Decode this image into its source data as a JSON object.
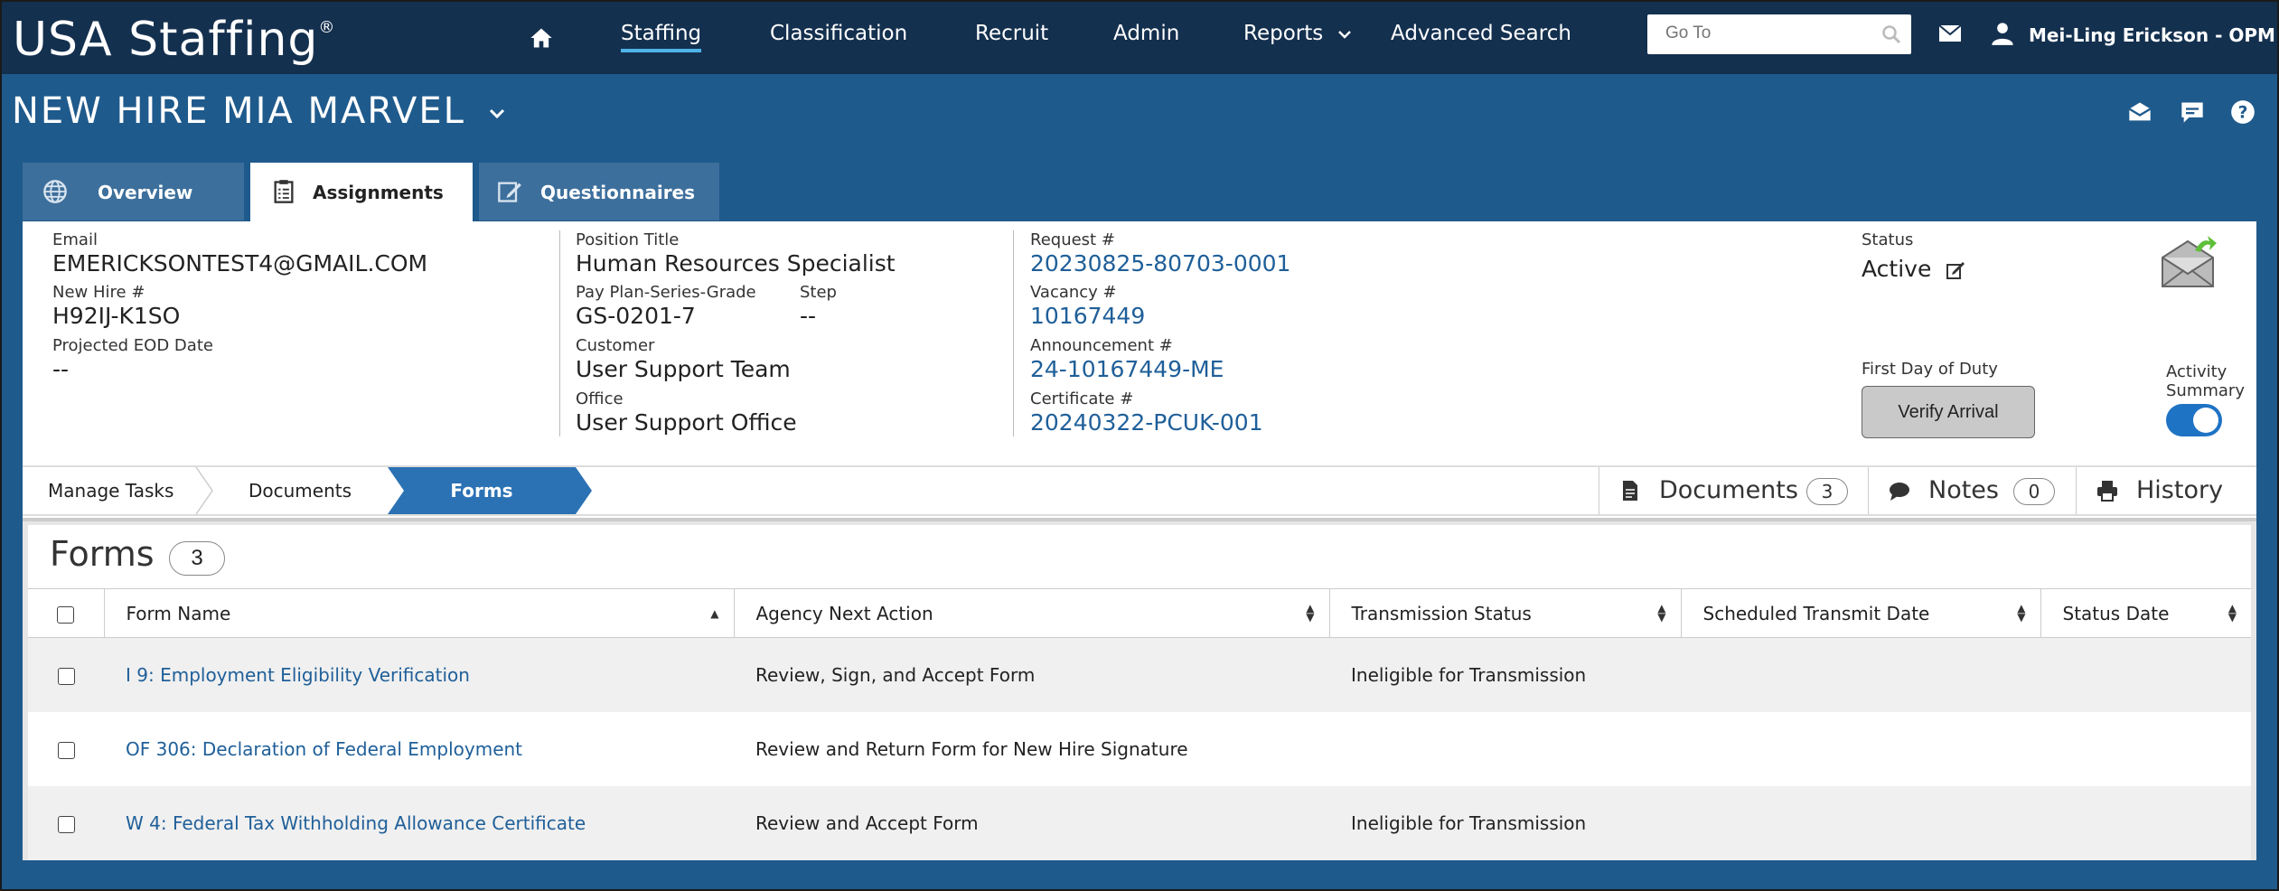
{
  "app": {
    "logo": "USA Staffing",
    "logo_mark": "®"
  },
  "nav": {
    "items": [
      "Staffing",
      "Classification",
      "Recruit",
      "Admin",
      "Reports",
      "Advanced Search"
    ],
    "active": "Staffing",
    "goto_placeholder": "Go To",
    "user_name": "Mei-Ling Erickson - OPM"
  },
  "page": {
    "title": "NEW HIRE MIA MARVEL"
  },
  "tabs": [
    "Overview",
    "Assignments",
    "Questionnaires"
  ],
  "active_tab": "Assignments",
  "info": {
    "email_label": "Email",
    "email": "EMERICKSONTEST4@GMAIL.COM",
    "new_hire_label": "New Hire #",
    "new_hire": "H92IJ-K1SO",
    "eod_label": "Projected EOD Date",
    "eod": "--",
    "position_label": "Position Title",
    "position": "Human Resources Specialist",
    "ppsg_label": "Pay Plan-Series-Grade",
    "ppsg": "GS-0201-7",
    "step_label": "Step",
    "step": "--",
    "customer_label": "Customer",
    "customer": "User Support Team",
    "office_label": "Office",
    "office": "User Support Office",
    "request_label": "Request #",
    "request": "20230825-80703-0001",
    "vacancy_label": "Vacancy #",
    "vacancy": "10167449",
    "announcement_label": "Announcement #",
    "announcement": "24-10167449-ME",
    "certificate_label": "Certificate #",
    "certificate": "20240322-PCUK-001",
    "status_label": "Status",
    "status": "Active",
    "first_day_label": "First Day of Duty",
    "verify_label": "Verify Arrival",
    "activity_label_1": "Activity",
    "activity_label_2": "Summary",
    "activity_on": true
  },
  "breadcrumb": [
    "Manage Tasks",
    "Documents",
    "Forms"
  ],
  "right_tabs": [
    {
      "label": "Documents",
      "count": "3",
      "icon": "document-icon"
    },
    {
      "label": "Notes",
      "count": "0",
      "icon": "speech-bubble-icon"
    },
    {
      "label": "History",
      "count": null,
      "icon": "printer-icon"
    }
  ],
  "forms": {
    "title": "Forms",
    "count": "3",
    "columns": [
      "Form Name",
      "Agency Next Action",
      "Transmission Status",
      "Scheduled Transmit Date",
      "Status Date"
    ],
    "rows": [
      {
        "name": "I 9: Employment Eligibility Verification",
        "action": "Review, Sign, and Accept Form",
        "transmission": "Ineligible for Transmission",
        "scheduled": "",
        "status_date": ""
      },
      {
        "name": "OF 306: Declaration of Federal Employment",
        "action": "Review and Return Form for New Hire Signature",
        "transmission": "",
        "scheduled": "",
        "status_date": ""
      },
      {
        "name": "W 4: Federal Tax Withholding Allowance Certificate",
        "action": "Review and Accept Form",
        "transmission": "Ineligible for Transmission",
        "scheduled": "",
        "status_date": ""
      }
    ]
  },
  "colors": {
    "nav_bg": "#14304f",
    "page_bg": "#1f5a8c",
    "tab_bg": "#3d6f9c",
    "accent": "#2b72b4",
    "link": "#1f5f99"
  }
}
